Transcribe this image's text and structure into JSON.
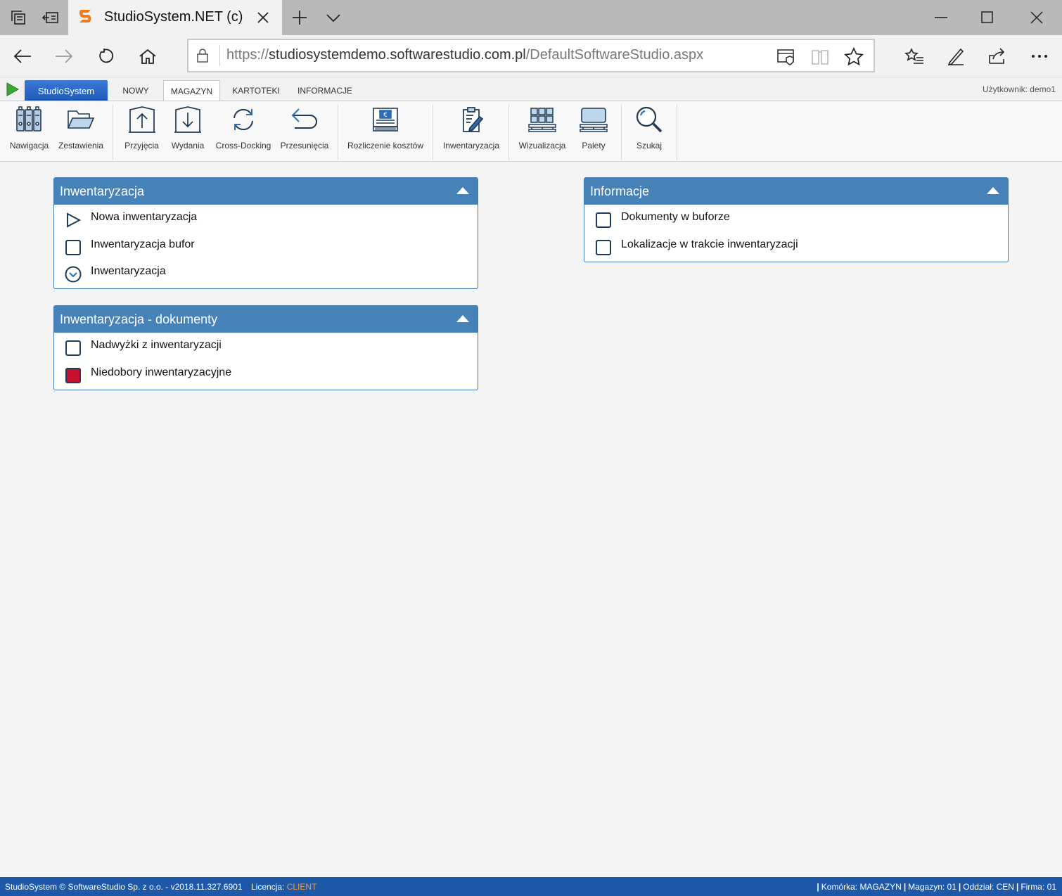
{
  "browser": {
    "tab_title": "StudioSystem.NET (c) SoftwareStudio",
    "url_scheme": "https://",
    "url_host": "studiosystemdemo.softwarestudio.com.pl",
    "url_path": "/DefaultSoftwareStudio.aspx"
  },
  "app": {
    "brand_label": "StudioSystem",
    "menu_tabs": [
      "NOWY",
      "MAGAZYN",
      "KARTOTEKI",
      "INFORMACJE"
    ],
    "active_tab": "MAGAZYN",
    "user_label": "Użytkownik: demo1"
  },
  "ribbon": {
    "items": [
      {
        "label": "Nawigacja",
        "icon": "binders-icon"
      },
      {
        "label": "Zestawienia",
        "icon": "folder-icon"
      },
      {
        "label": "Przyjęcia",
        "icon": "box-arrow-up-icon"
      },
      {
        "label": "Wydania",
        "icon": "box-arrow-down-icon"
      },
      {
        "label": "Cross-Docking",
        "icon": "sync-icon"
      },
      {
        "label": "Przesunięcia",
        "icon": "undo-arrow-icon"
      },
      {
        "label": "Rozliczenie kosztów",
        "icon": "euro-banknote-icon"
      },
      {
        "label": "Inwentaryzacja",
        "icon": "clipboard-pen-icon"
      },
      {
        "label": "Wizualizacja",
        "icon": "pallet-boxes-icon"
      },
      {
        "label": "Palety",
        "icon": "pallet-icon"
      },
      {
        "label": "Szukaj",
        "icon": "magnifier-icon"
      }
    ]
  },
  "panels": {
    "inwentaryzacja": {
      "title": "Inwentaryzacja",
      "items": [
        {
          "label": "Nowa inwentaryzacja",
          "icon": "play-outline-icon"
        },
        {
          "label": "Inwentaryzacja bufor",
          "icon": "checkbox-empty-icon"
        },
        {
          "label": "Inwentaryzacja",
          "icon": "circle-chevron-down-icon"
        }
      ]
    },
    "dokumenty": {
      "title": "Inwentaryzacja - dokumenty",
      "items": [
        {
          "label": "Nadwyżki z inwentaryzacji",
          "icon": "checkbox-empty-icon"
        },
        {
          "label": "Niedobory inwentaryzacyjne",
          "icon": "checkbox-red-icon"
        }
      ]
    },
    "informacje": {
      "title": "Informacje",
      "items": [
        {
          "label": "Dokumenty w buforze",
          "icon": "checkbox-empty-icon"
        },
        {
          "label": "Lokalizacje w trakcie inwentaryzacji",
          "icon": "checkbox-empty-icon"
        }
      ]
    }
  },
  "status": {
    "copyright": "StudioSystem © SoftwareStudio Sp. z o.o. - v2018.11.327.6901",
    "license_label": "Licencja:",
    "license_value": "CLIENT",
    "komorka": "Komórka: MAGAZYN",
    "magazyn": "Magazyn: 01",
    "oddzial": "Oddział: CEN",
    "firma": "Firma: 01"
  },
  "colors": {
    "panel_header": "#4681b8",
    "status_bar": "#1d59a8",
    "license_accent": "#f29c38",
    "red_checkbox": "#c8102e"
  }
}
